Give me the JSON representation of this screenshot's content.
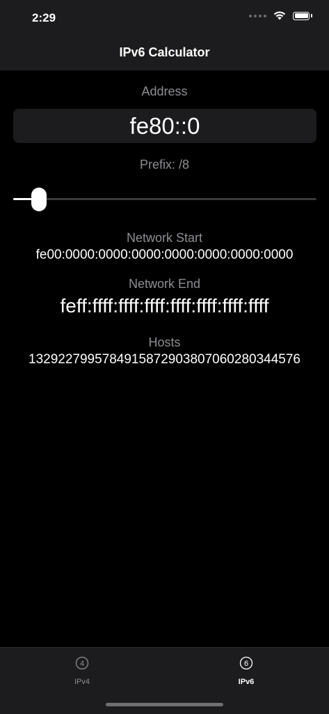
{
  "status_bar": {
    "time": "2:29"
  },
  "nav": {
    "title": "IPv6 Calculator"
  },
  "address": {
    "label": "Address",
    "value": "fe80::0"
  },
  "prefix": {
    "label": "Prefix: /8",
    "slider_fraction": 0.0625
  },
  "network_start": {
    "label": "Network Start",
    "value": "fe00:0000:0000:0000:0000:0000:0000:0000"
  },
  "network_end": {
    "label": "Network End",
    "value": "feff:ffff:ffff:ffff:ffff:ffff:ffff:ffff"
  },
  "hosts": {
    "label": "Hosts",
    "value": "1329227995784915872903807060280344576"
  },
  "tabs": [
    {
      "label": "IPv4",
      "icon": "circled-4-icon",
      "icon_glyph": "4",
      "selected": false
    },
    {
      "label": "IPv6",
      "icon": "circled-6-icon",
      "icon_glyph": "6",
      "selected": true
    }
  ],
  "colors": {
    "background": "#000000",
    "bar": "#1c1c1e",
    "secondary_text": "#8e8e93",
    "selected_tab": "#ffffff",
    "unselected_tab": "#8e8e93"
  }
}
